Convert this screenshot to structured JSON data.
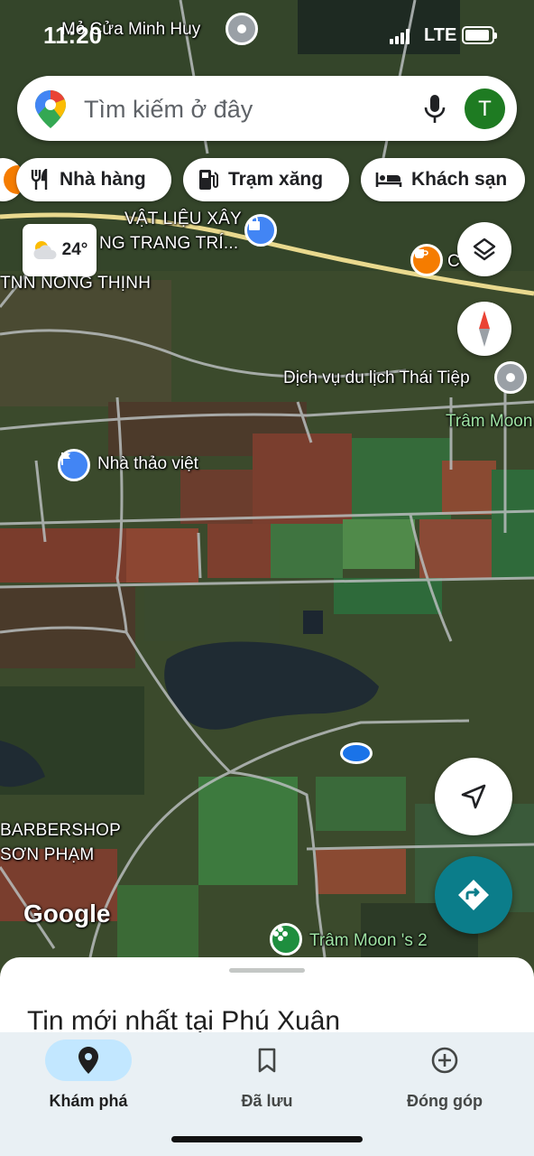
{
  "status_bar": {
    "time": "11:20",
    "network": "LTE"
  },
  "search": {
    "placeholder": "Tìm kiếm ở đây",
    "avatar_letter": "T"
  },
  "chips": [
    {
      "label": "Nhà hàng",
      "icon": "fork-knife-icon"
    },
    {
      "label": "Trạm xăng",
      "icon": "gas-station-icon"
    },
    {
      "label": "Khách sạn",
      "icon": "bed-icon"
    }
  ],
  "weather": {
    "temperature": "24°",
    "icon": "partly-cloudy-icon"
  },
  "map_labels": {
    "place_top": "Mỏ Cửa Minh Huy",
    "store_line1": "VẬT LIỆU XÂY",
    "store_line2": "NG TRANG TRÍ...",
    "nong_thinh": "TNN NONG THỊNH",
    "cafe": "C e Ar",
    "travel": "Dịch vụ du lịch Thái Tiệp",
    "tram_moon": "Trâm Moon",
    "nha_thao": "Nhà thảo việt",
    "barber1": "BARBERSHOP",
    "barber2": "SƠN PHẠM",
    "google": "Google",
    "tram_moon2": "Trâm Moon 's 2"
  },
  "sheet": {
    "title": "Tin mới nhất tại Phú Xuân"
  },
  "nav": [
    {
      "label": "Khám phá",
      "icon": "explore-pin-icon",
      "active": true
    },
    {
      "label": "Đã lưu",
      "icon": "bookmark-icon",
      "active": false
    },
    {
      "label": "Đóng góp",
      "icon": "add-circle-icon",
      "active": false
    }
  ],
  "colors": {
    "accent": "#0b7d8a",
    "active_nav": "#c2e7ff",
    "avatar": "#1e7b22"
  }
}
